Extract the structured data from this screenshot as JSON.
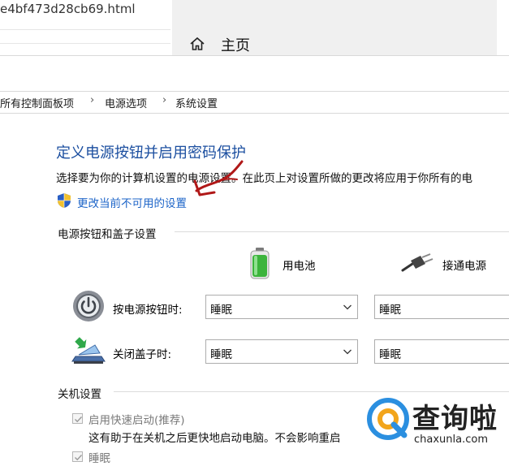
{
  "background": {
    "browser_url": "e4bf473d28cb69.html",
    "settings_home_label": "主页"
  },
  "breadcrumb": {
    "items": [
      "所有控制面板项",
      "电源选项",
      "系统设置"
    ],
    "separator": "›"
  },
  "page": {
    "title": "定义电源按钮并启用密码保护",
    "description": "选择要为你的计算机设置的电源设置。在此页上对设置所做的更改将应用于你所有的电",
    "change_link": "更改当前不可用的设置"
  },
  "power_section": {
    "heading": "电源按钮和盖子设置",
    "col_battery": "用电池",
    "col_plugged": "接通电源",
    "rows": [
      {
        "label": "按电源按钮时:",
        "battery": "睡眠",
        "plugged": "睡眠"
      },
      {
        "label": "关闭盖子时:",
        "battery": "睡眠",
        "plugged": "睡眠"
      }
    ]
  },
  "shutdown_section": {
    "heading": "关机设置",
    "fast_startup_label": "启用快速启动(推荐)",
    "fast_startup_desc": "这有助于在关机之后更快地启动电脑。不会影响重启",
    "sleep_label": "睡眠"
  },
  "watermark": {
    "name": "查询啦",
    "url": "chaxunla.com"
  },
  "colors": {
    "title_blue": "#1c4fa0",
    "link_blue": "#1c64c8",
    "annotation_red": "#b01818",
    "watermark_blue": "#2b8fe0"
  }
}
